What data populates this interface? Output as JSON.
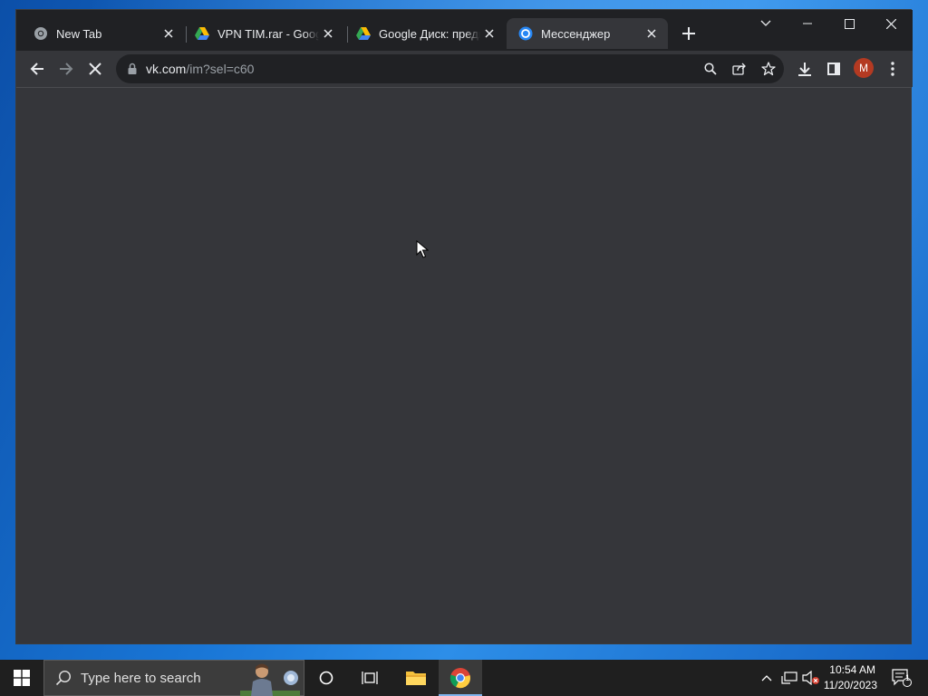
{
  "browser": {
    "tabs": [
      {
        "title": "New Tab",
        "icon": "chrome-icon"
      },
      {
        "title": "VPN TIM.rar - Google Drive",
        "icon": "google-drive-icon"
      },
      {
        "title": "Google Диск: предпросмотр",
        "icon": "google-drive-icon"
      },
      {
        "title": "Мессенджер",
        "icon": "vk-messenger-icon",
        "active": true
      }
    ],
    "address": {
      "host": "vk.com",
      "path": "/im?sel=c60"
    },
    "profile_initial": "M"
  },
  "taskbar": {
    "search_placeholder": "Type here to search",
    "time": "10:54 AM",
    "date": "11/20/2023",
    "notification_count": "1"
  },
  "colors": {
    "tab_strip": "#202124",
    "toolbar": "#35363a",
    "content": "#35363a",
    "profile": "#b43a22",
    "taskbar": "#1f1f1f"
  }
}
